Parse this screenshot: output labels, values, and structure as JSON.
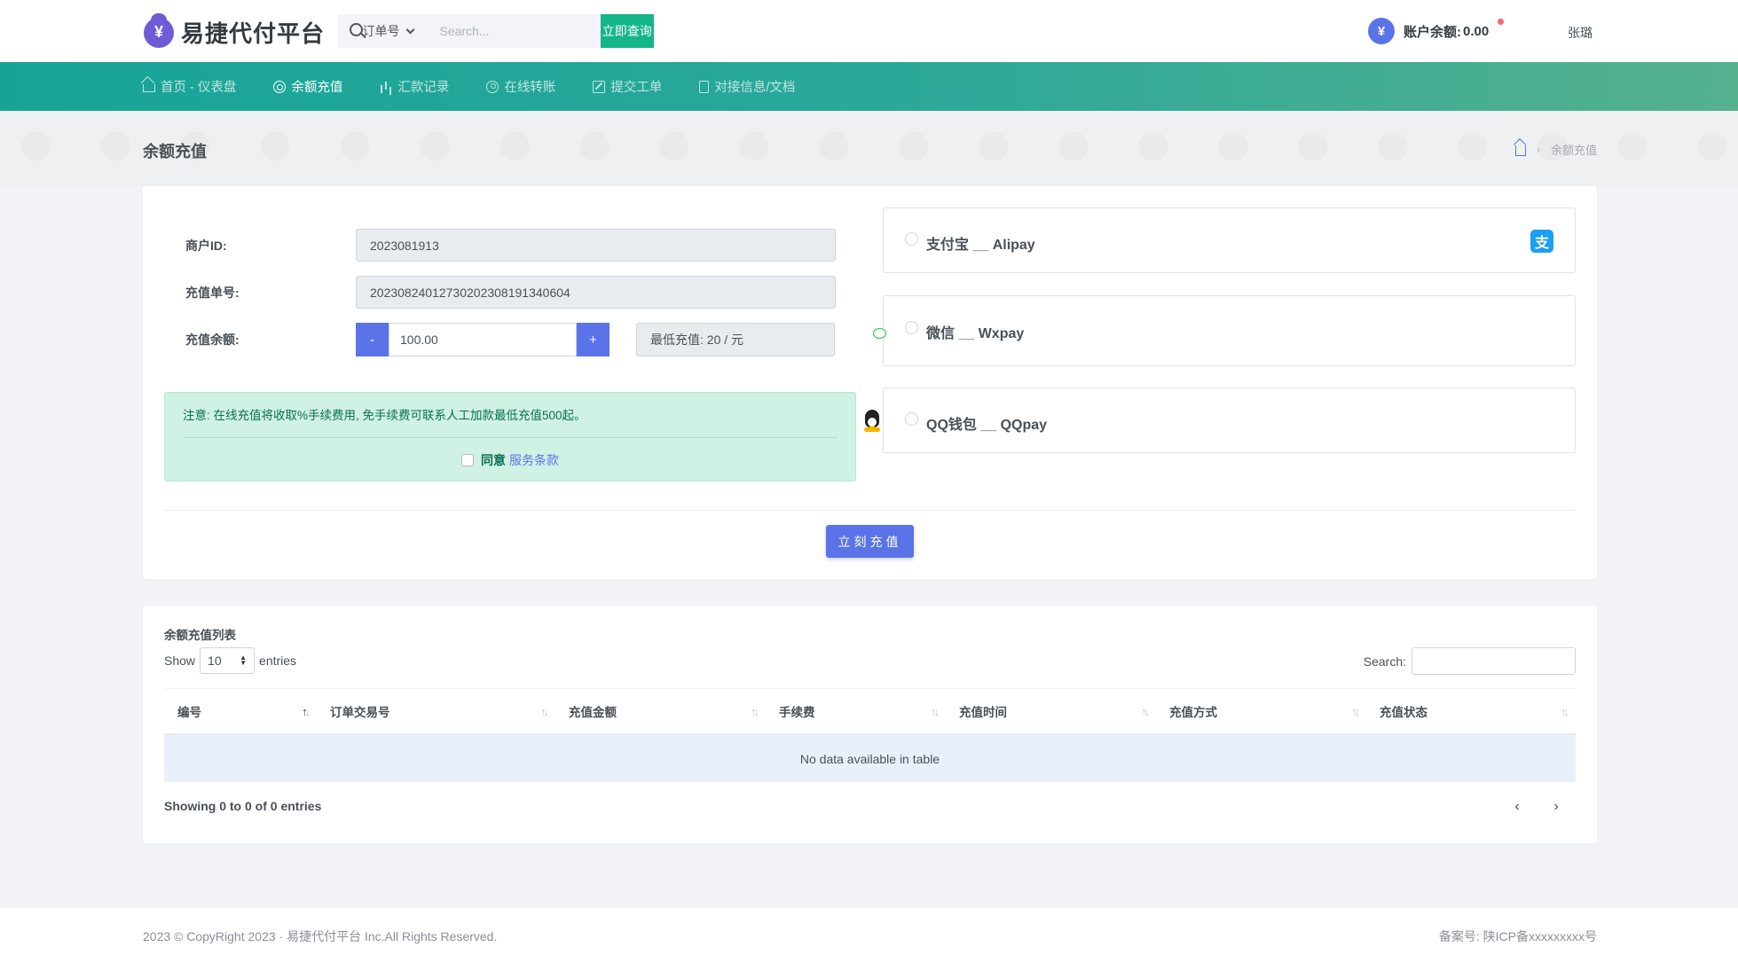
{
  "header": {
    "logo_icon": "¥",
    "logo_text": "易捷代付平台",
    "search": {
      "select_value": "订单号",
      "placeholder": "Search...",
      "button_label": "立即查询"
    },
    "balance": {
      "icon": "¥",
      "label": "账户余额:",
      "value": "0.00"
    },
    "username": "张璐"
  },
  "nav": {
    "items": [
      {
        "label": "首页 - 仪表盘",
        "icon": "home-icon"
      },
      {
        "label": "余额充值",
        "icon": "circle-icon",
        "active": true
      },
      {
        "label": "汇款记录",
        "icon": "bar-chart-icon"
      },
      {
        "label": "在线转账",
        "icon": "support-icon"
      },
      {
        "label": "提交工单",
        "icon": "edit-icon"
      },
      {
        "label": "对接信息/文档",
        "icon": "document-icon"
      }
    ]
  },
  "page": {
    "title": "余额充值",
    "breadcrumb_current": "余额充值"
  },
  "form": {
    "merchant_label": "商户ID:",
    "merchant_value": "2023081913",
    "order_label": "充值单号:",
    "order_value": "20230824012730202308191340604",
    "amount_label": "充值余额:",
    "minus_label": "-",
    "amount_value": "100.00",
    "plus_label": "+",
    "min_text": "最低充值: 20 / 元"
  },
  "notice": {
    "text": "注意: 在线充值将收取%手续费用, 免手续费可联系人工加款最低充值500起。",
    "agree_label": "同意",
    "agree_link": "服务条款"
  },
  "payment_methods": [
    {
      "label": "支付宝 __ Alipay",
      "icon": "alipay-icon",
      "glyph": "支"
    },
    {
      "label": "微信 __ Wxpay",
      "icon": "wechat-icon"
    },
    {
      "label": "QQ钱包 __ QQpay",
      "icon": "qq-icon"
    }
  ],
  "submit_label": "立刻充值",
  "table": {
    "title": "余额充值列表",
    "show_label": "Show",
    "length_value": "10",
    "entries_label": "entries",
    "search_label": "Search:",
    "columns": [
      "编号",
      "订单交易号",
      "充值金额",
      "手续费",
      "充值时间",
      "充值方式",
      "充值状态"
    ],
    "empty_text": "No data available in table",
    "info": "Showing 0 to 0 of 0 entries",
    "prev": "‹",
    "next": "›"
  },
  "footer": {
    "copyright": "2023 © CopyRight 2023 · 易捷代付平台 Inc.All Rights Reserved.",
    "icp": "备案号: 陕ICP备xxxxxxxxx号"
  },
  "colors": {
    "primary": "#5b73e8",
    "success": "#15b58a",
    "nav_start": "#17a497",
    "nav_end": "#55b08e"
  }
}
